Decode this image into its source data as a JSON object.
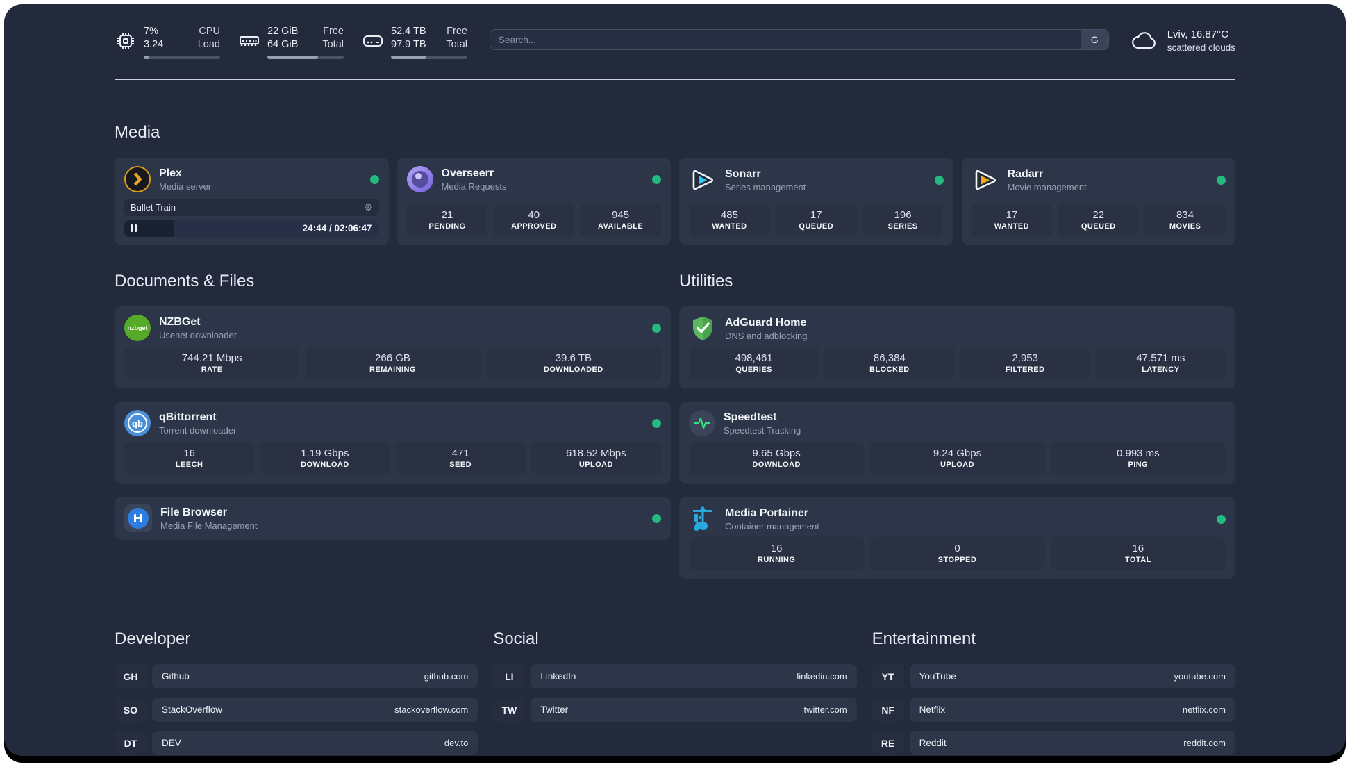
{
  "header": {
    "cpu": {
      "value_top": "7%",
      "value_bottom": "3.24",
      "label_top": "CPU",
      "label_bottom": "Load",
      "bar_percent": 7
    },
    "memory": {
      "value_top": "22 GiB",
      "value_bottom": "64 GiB",
      "label_top": "Free",
      "label_bottom": "Total",
      "bar_percent": 66
    },
    "disk": {
      "value_top": "52.4 TB",
      "value_bottom": "97.9 TB",
      "label_top": "Free",
      "label_bottom": "Total",
      "bar_percent": 46
    },
    "search": {
      "placeholder": "Search...",
      "engine_badge": "G"
    },
    "weather": {
      "location": "Lviv, 16.87°C",
      "condition": "scattered clouds"
    }
  },
  "colors": {
    "status_online": "#23ba81",
    "accent_green": "#35e08b",
    "plex_amber": "#e8a22c"
  },
  "sections": {
    "media": {
      "title": "Media"
    },
    "documents": {
      "title": "Documents & Files"
    },
    "utilities": {
      "title": "Utilities"
    },
    "developer": {
      "title": "Developer"
    },
    "social": {
      "title": "Social"
    },
    "entertainment": {
      "title": "Entertainment"
    }
  },
  "apps": {
    "plex": {
      "name": "Plex",
      "desc": "Media server",
      "now_playing": "Bullet Train",
      "time": "24:44 / 02:06:47",
      "progress_percent": 19.4
    },
    "overseerr": {
      "name": "Overseerr",
      "desc": "Media Requests",
      "stats": [
        {
          "value": "21",
          "label": "PENDING"
        },
        {
          "value": "40",
          "label": "APPROVED"
        },
        {
          "value": "945",
          "label": "AVAILABLE"
        }
      ]
    },
    "sonarr": {
      "name": "Sonarr",
      "desc": "Series management",
      "stats": [
        {
          "value": "485",
          "label": "WANTED"
        },
        {
          "value": "17",
          "label": "QUEUED"
        },
        {
          "value": "196",
          "label": "SERIES"
        }
      ]
    },
    "radarr": {
      "name": "Radarr",
      "desc": "Movie management",
      "stats": [
        {
          "value": "17",
          "label": "WANTED"
        },
        {
          "value": "22",
          "label": "QUEUED"
        },
        {
          "value": "834",
          "label": "MOVIES"
        }
      ]
    },
    "nzbget": {
      "name": "NZBGet",
      "desc": "Usenet downloader",
      "logo_text": "nzbget",
      "stats": [
        {
          "value": "744.21 Mbps",
          "label": "RATE"
        },
        {
          "value": "266 GB",
          "label": "REMAINING"
        },
        {
          "value": "39.6 TB",
          "label": "DOWNLOADED"
        }
      ]
    },
    "qbittorrent": {
      "name": "qBittorrent",
      "desc": "Torrent downloader",
      "logo_text": "qb",
      "stats": [
        {
          "value": "16",
          "label": "LEECH"
        },
        {
          "value": "1.19 Gbps",
          "label": "DOWNLOAD"
        },
        {
          "value": "471",
          "label": "SEED"
        },
        {
          "value": "618.52 Mbps",
          "label": "UPLOAD"
        }
      ]
    },
    "filebrowser": {
      "name": "File Browser",
      "desc": "Media File Management"
    },
    "adguard": {
      "name": "AdGuard Home",
      "desc": "DNS and adblocking",
      "stats": [
        {
          "value": "498,461",
          "label": "QUERIES"
        },
        {
          "value": "86,384",
          "label": "BLOCKED"
        },
        {
          "value": "2,953",
          "label": "FILTERED"
        },
        {
          "value": "47.571 ms",
          "label": "LATENCY"
        }
      ]
    },
    "speedtest": {
      "name": "Speedtest",
      "desc": "Speedtest Tracking",
      "stats": [
        {
          "value": "9.65 Gbps",
          "label": "DOWNLOAD"
        },
        {
          "value": "9.24 Gbps",
          "label": "UPLOAD"
        },
        {
          "value": "0.993 ms",
          "label": "PING"
        }
      ]
    },
    "portainer": {
      "name": "Media Portainer",
      "desc": "Container management",
      "stats": [
        {
          "value": "16",
          "label": "RUNNING"
        },
        {
          "value": "0",
          "label": "STOPPED"
        },
        {
          "value": "16",
          "label": "TOTAL"
        }
      ]
    }
  },
  "bookmarks": {
    "developer": [
      {
        "abbr": "GH",
        "name": "Github",
        "url": "github.com"
      },
      {
        "abbr": "SO",
        "name": "StackOverflow",
        "url": "stackoverflow.com"
      },
      {
        "abbr": "DT",
        "name": "DEV",
        "url": "dev.to"
      }
    ],
    "social": [
      {
        "abbr": "LI",
        "name": "LinkedIn",
        "url": "linkedin.com"
      },
      {
        "abbr": "TW",
        "name": "Twitter",
        "url": "twitter.com"
      }
    ],
    "entertainment": [
      {
        "abbr": "YT",
        "name": "YouTube",
        "url": "youtube.com"
      },
      {
        "abbr": "NF",
        "name": "Netflix",
        "url": "netflix.com"
      },
      {
        "abbr": "RE",
        "name": "Reddit",
        "url": "reddit.com"
      }
    ]
  }
}
